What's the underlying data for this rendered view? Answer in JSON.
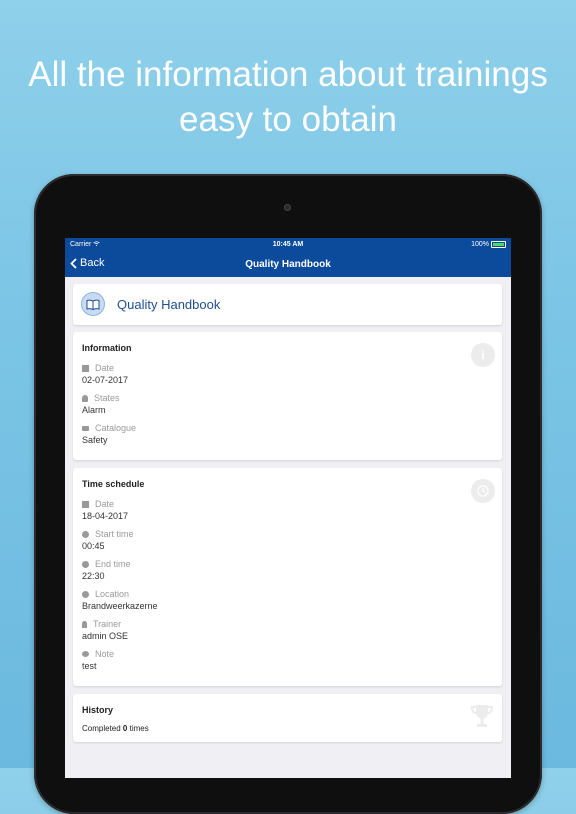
{
  "headline": {
    "line1": "All the information about trainings",
    "line2": "easy to obtain"
  },
  "status_bar": {
    "carrier": "Carrier",
    "time": "10:45 AM",
    "battery": "100%"
  },
  "nav": {
    "back_label": "Back",
    "title": "Quality Handbook"
  },
  "handbook_card": {
    "title": "Quality Handbook",
    "icon": "book-icon"
  },
  "information": {
    "title": "Information",
    "badge_icon": "info-icon",
    "fields": [
      {
        "label": "Date",
        "value": "02-07-2017",
        "icon": "calendar-icon"
      },
      {
        "label": "States",
        "value": "Alarm",
        "icon": "bell-icon"
      },
      {
        "label": "Catalogue",
        "value": "Safety",
        "icon": "catalogue-icon"
      }
    ]
  },
  "time_schedule": {
    "title": "Time schedule",
    "badge_icon": "clock-icon",
    "fields": [
      {
        "label": "Date",
        "value": "18-04-2017",
        "icon": "calendar-icon"
      },
      {
        "label": "Start time",
        "value": "00:45",
        "icon": "clock-icon"
      },
      {
        "label": "End time",
        "value": "22:30",
        "icon": "clock-icon"
      },
      {
        "label": "Location",
        "value": "Brandweerkazerne",
        "icon": "location-icon"
      },
      {
        "label": "Trainer",
        "value": "admin OSE",
        "icon": "user-icon"
      },
      {
        "label": "Note",
        "value": "test",
        "icon": "comment-icon"
      }
    ]
  },
  "history": {
    "title": "History",
    "badge_icon": "trophy-icon",
    "completed_prefix": "Completed",
    "completed_count": "0",
    "completed_suffix": "times"
  },
  "colors": {
    "brand_blue": "#0c4a9c",
    "background_gradient_top": "#8fd0ea",
    "card_title_blue": "#1f4f8f"
  }
}
